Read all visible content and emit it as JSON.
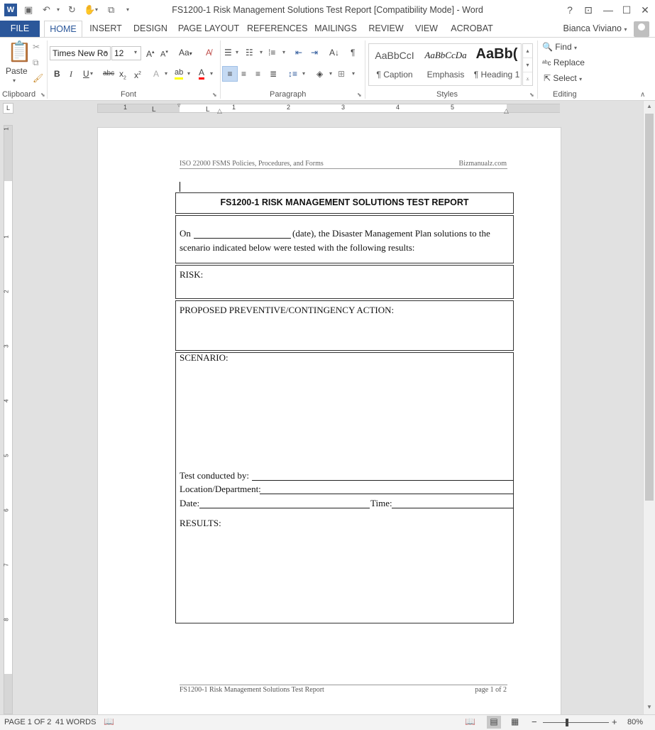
{
  "window": {
    "title": "FS1200-1 Risk Management Solutions Test Report [Compatibility Mode] - Word",
    "help_label": "?",
    "user_name": "Bianca Viviano"
  },
  "tabs": [
    {
      "label": "FILE"
    },
    {
      "label": "HOME"
    },
    {
      "label": "INSERT"
    },
    {
      "label": "DESIGN"
    },
    {
      "label": "PAGE LAYOUT"
    },
    {
      "label": "REFERENCES"
    },
    {
      "label": "MAILINGS"
    },
    {
      "label": "REVIEW"
    },
    {
      "label": "VIEW"
    },
    {
      "label": "ACROBAT"
    }
  ],
  "ribbon": {
    "clipboard": {
      "paste_label": "Paste",
      "group_label": "Clipboard"
    },
    "font": {
      "font_name": "Times New Ro",
      "font_size": "12",
      "group_label": "Font"
    },
    "paragraph": {
      "group_label": "Paragraph"
    },
    "styles": {
      "group_label": "Styles",
      "items": [
        {
          "preview": "AaBbCcI",
          "name": "¶ Caption"
        },
        {
          "preview": "AaBbCcDa",
          "name": "Emphasis"
        },
        {
          "preview": "AaBb(",
          "name": "¶ Heading 1"
        }
      ]
    },
    "editing": {
      "find_label": "Find",
      "replace_label": "Replace",
      "select_label": "Select",
      "group_label": "Editing"
    }
  },
  "ruler": {
    "numbers": [
      "1",
      "1",
      "2",
      "3",
      "4",
      "5"
    ],
    "vnumbers": [
      "1",
      "1",
      "2",
      "3",
      "4",
      "5",
      "6",
      "7",
      "8"
    ]
  },
  "document": {
    "header_left": "ISO 22000 FSMS Policies, Procedures, and Forms",
    "header_right": "Bizmanualz.com",
    "form_title": "FS1200-1 RISK MANAGEMENT SOLUTIONS TEST REPORT",
    "intro_line1_a": "On",
    "intro_line1_b": "(date), the Disaster Management Plan solutions to the",
    "intro_line2": "scenario indicated below were tested with the following results:",
    "risk_label": "RISK:",
    "action_label": "PROPOSED PREVENTIVE/CONTINGENCY ACTION:",
    "scenario_label": "SCENARIO:",
    "test_conducted_label": "Test conducted by:",
    "location_label": "Location/Department:",
    "date_label": "Date:",
    "time_label": "Time:",
    "results_label": "RESULTS:",
    "footer_left": "FS1200-1 Risk Management Solutions Test Report",
    "footer_right": "page 1 of 2"
  },
  "status": {
    "page": "PAGE 1 OF 2",
    "words": "41 WORDS",
    "zoom_minus": "−",
    "zoom_plus": "+",
    "zoom": "80%"
  }
}
